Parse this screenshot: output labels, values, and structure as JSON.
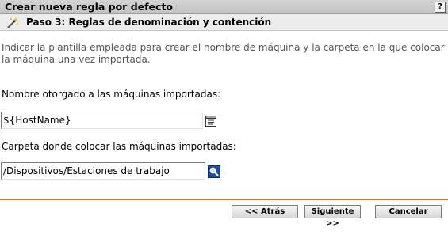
{
  "window": {
    "title": "Crear nueva regla por defecto",
    "help_label": "?"
  },
  "step": {
    "title": "Paso 3: Reglas de denominación y contención",
    "icon": "wand-icon"
  },
  "description": "Indicar la plantilla empleada para crear el nombre de máquina y la carpeta en la que colocar la máquina una vez importada.",
  "fields": {
    "name": {
      "label": "Nombre otorgado a las máquinas importadas:",
      "value": "${HostName}",
      "icon": "variable-list-icon"
    },
    "folder": {
      "label": "Carpeta donde colocar las máquinas importadas:",
      "value": "/Dispositivos/Estaciones de trabajo",
      "icon": "browse-magnifier-icon"
    }
  },
  "buttons": {
    "back": "<< Atrás",
    "next": "Siguiente >>",
    "cancel": "Cancelar"
  },
  "colors": {
    "accent_divider": "#c77a3a",
    "browse_icon": "#1e4f9a"
  }
}
